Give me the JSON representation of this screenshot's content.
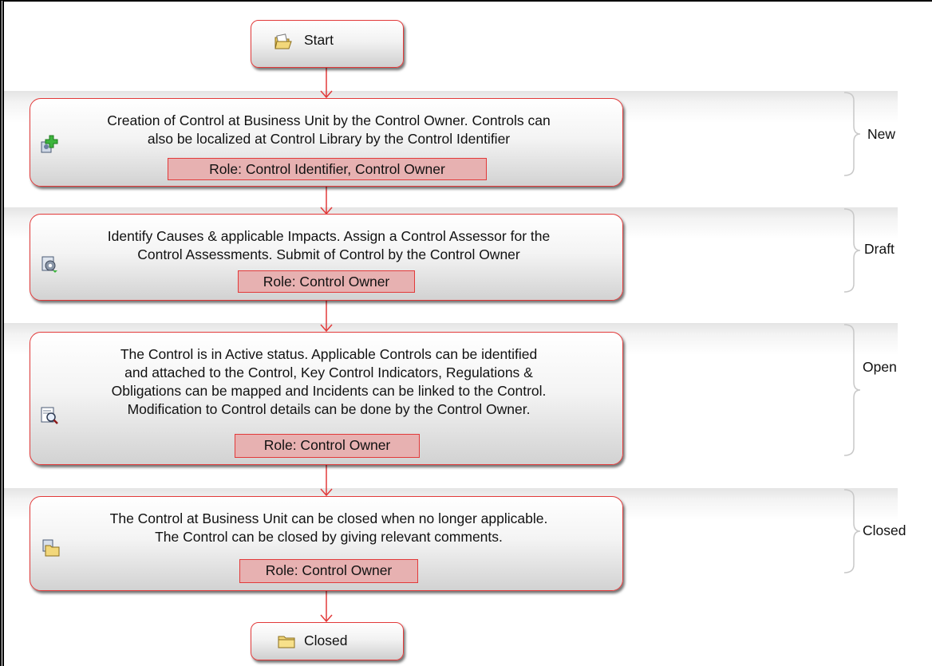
{
  "start": {
    "label": "Start",
    "icon": "open-folder-icon"
  },
  "end": {
    "label": "Closed",
    "icon": "folder-icon"
  },
  "steps": [
    {
      "status": "New",
      "icon": "add-control-icon",
      "lines": [
        "Creation of Control at Business Unit by the Control Owner.  Controls can",
        "also be localized at Control Library by the Control Identifier"
      ],
      "role": "Role: Control Identifier, Control Owner"
    },
    {
      "status": "Draft",
      "icon": "settings-gear-icon",
      "lines": [
        "Identify Causes & applicable Impacts. Assign a Control Assessor for the",
        "Control Assessments. Submit of Control by the Control Owner"
      ],
      "role": "Role: Control Owner"
    },
    {
      "status": "Open",
      "icon": "search-document-icon",
      "lines": [
        "The Control is in Active status. Applicable Controls can be identified",
        "and attached to the Control, Key Control Indicators, Regulations &",
        "Obligations can be mapped and Incidents can be linked to the Control.",
        "Modification to Control details can be done by the Control Owner."
      ],
      "role": "Role: Control Owner"
    },
    {
      "status": "Closed",
      "icon": "folder-stack-icon",
      "lines": [
        "The Control at Business Unit can be closed when no longer applicable.",
        "The Control can be closed by giving relevant comments."
      ],
      "role": "Role: Control Owner"
    }
  ],
  "colors": {
    "border": "#e23a3a",
    "role_fill": "#e7b1b1",
    "arrow": "#e23a3a"
  }
}
